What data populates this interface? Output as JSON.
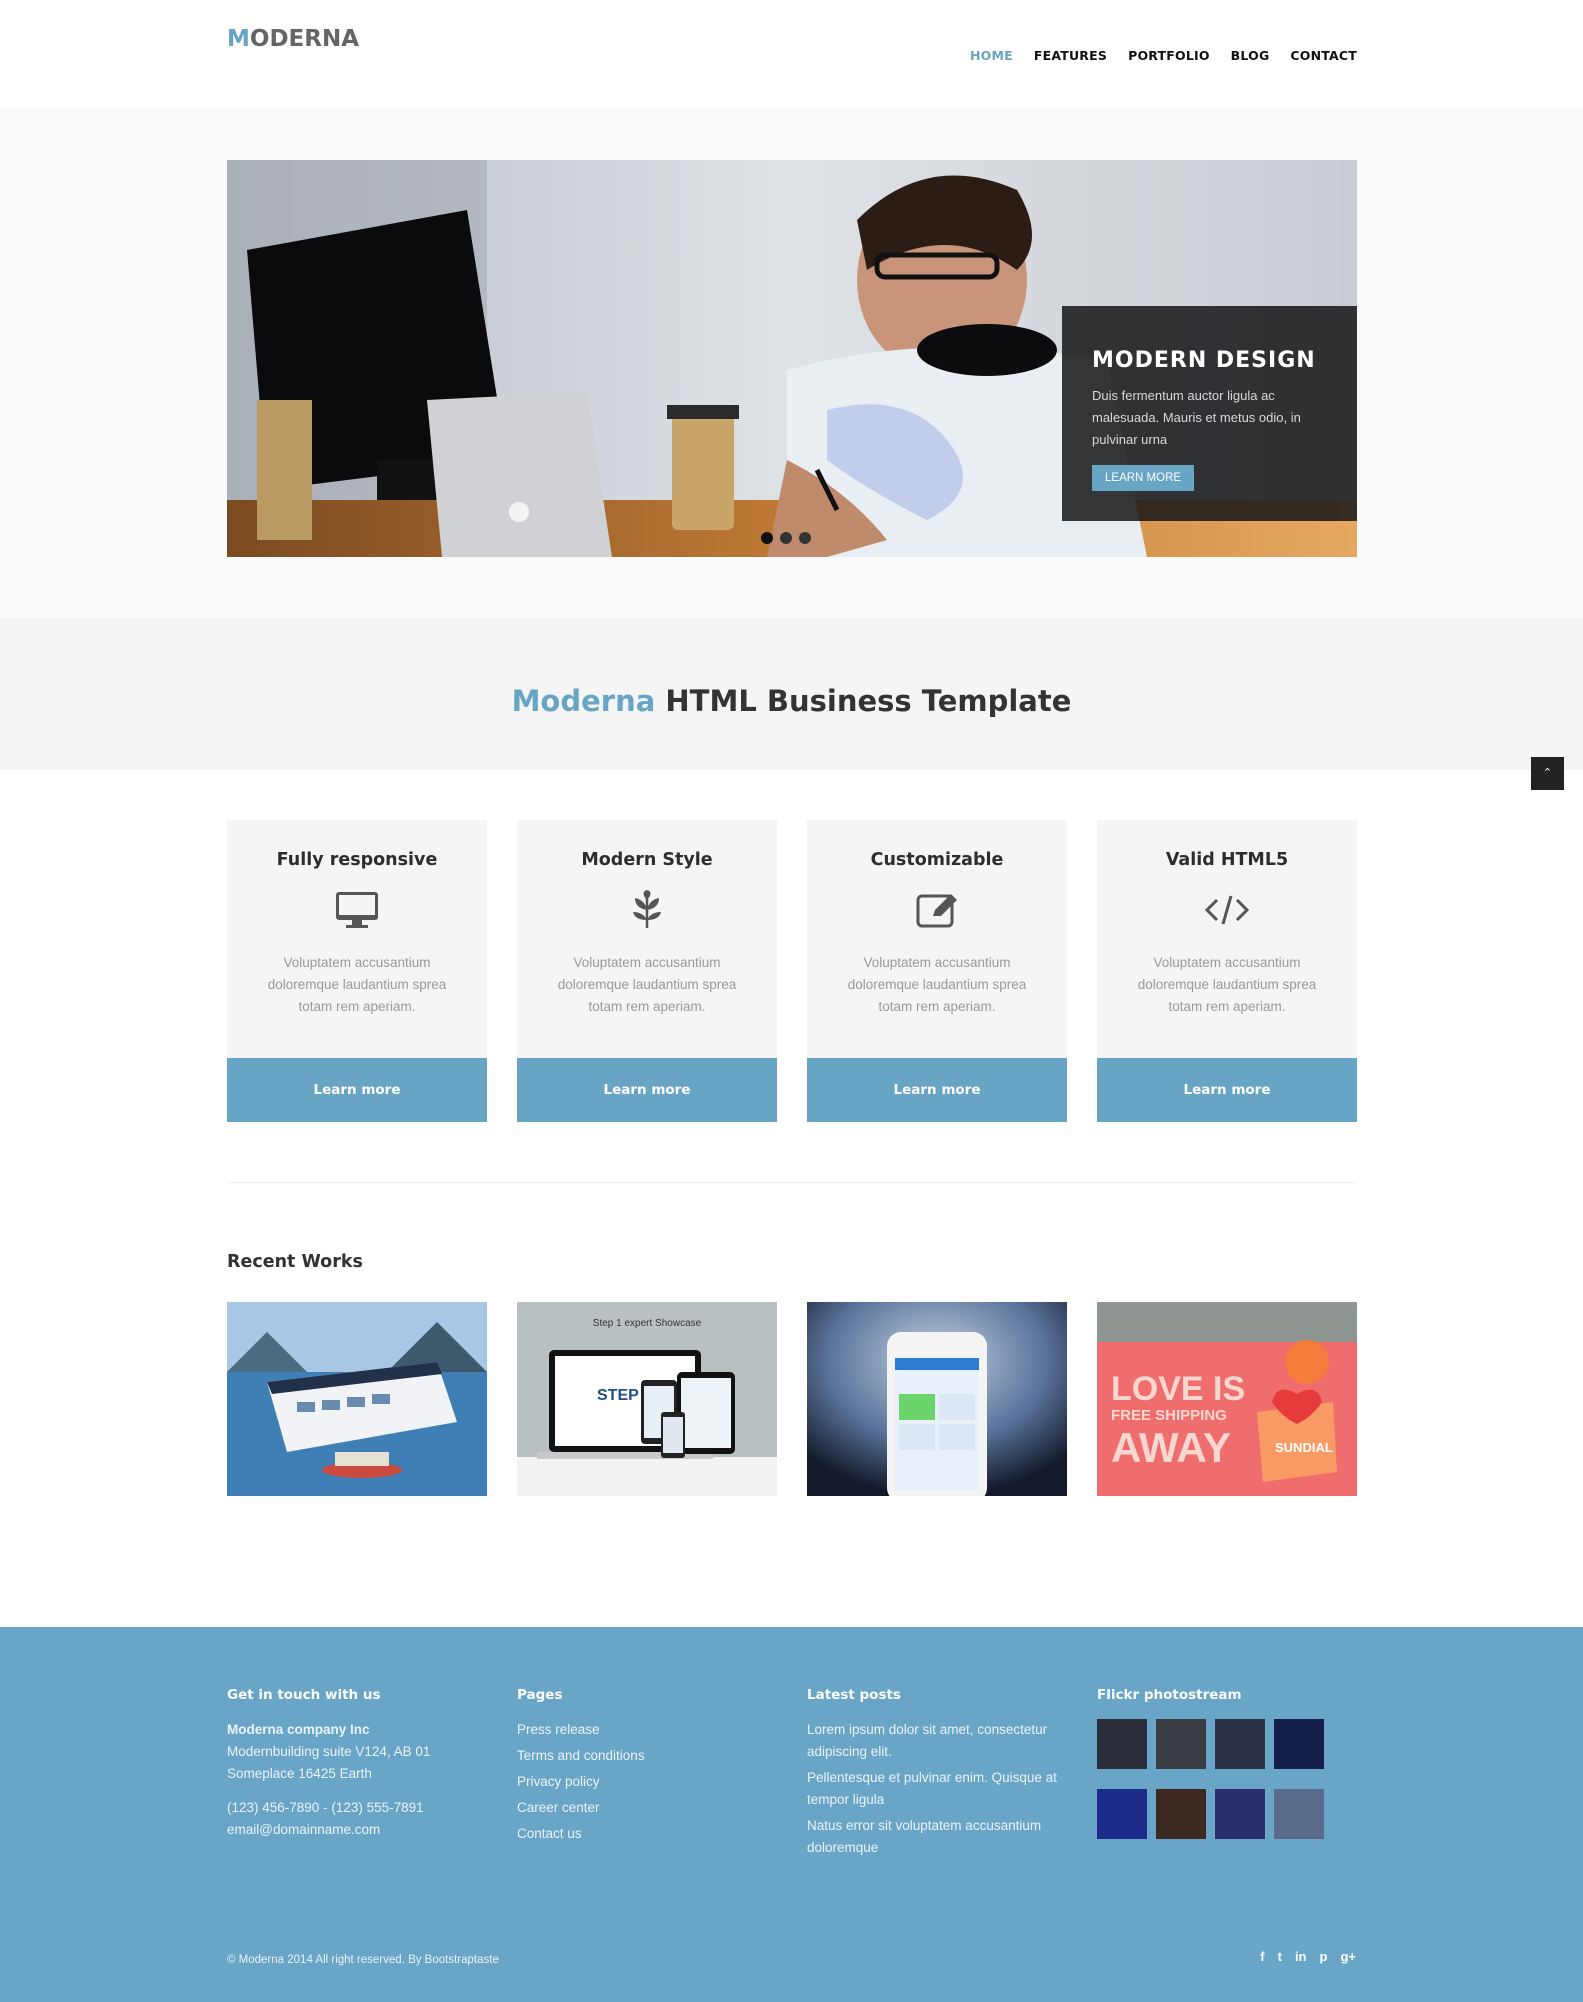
{
  "brand": {
    "first_letter": "M",
    "rest": "ODERNA"
  },
  "nav": [
    "HOME",
    "FEATURES",
    "PORTFOLIO",
    "BLOG",
    "CONTACT"
  ],
  "slider": {
    "title": "MODERN DESIGN",
    "text": "Duis fermentum auctor ligula ac malesuada. Mauris et metus odio, in pulvinar urna",
    "button": "LEARN MORE"
  },
  "callout": {
    "highlight": "Moderna",
    "rest": " HTML Business Template"
  },
  "scroll_top_icon": "⌃",
  "features": [
    {
      "title": "Fully responsive",
      "icon": "desktop-icon",
      "text": "Voluptatem accusantium doloremque laudantium sprea totam rem aperiam.",
      "button": "Learn more"
    },
    {
      "title": "Modern Style",
      "icon": "leaf-icon",
      "text": "Voluptatem accusantium doloremque laudantium sprea totam rem aperiam.",
      "button": "Learn more"
    },
    {
      "title": "Customizable",
      "icon": "edit-icon",
      "text": "Voluptatem accusantium doloremque laudantium sprea totam rem aperiam.",
      "button": "Learn more"
    },
    {
      "title": "Valid HTML5",
      "icon": "code-icon",
      "text": "Voluptatem accusantium doloremque laudantium sprea totam rem aperiam.",
      "button": "Learn more"
    }
  ],
  "recent_works": {
    "title": "Recent Works",
    "items": [
      {
        "name": "lake-website-mockup"
      },
      {
        "name": "step1-showcase",
        "caption": "Step 1 expert Showcase"
      },
      {
        "name": "phone-app"
      },
      {
        "name": "love-is-away",
        "lines": [
          "LOVE IS",
          "FREE SHIPPING",
          "AWAY"
        ],
        "brand": "SUNDIAL"
      }
    ]
  },
  "footer": {
    "contact": {
      "heading": "Get in touch with us",
      "company": "Moderna company Inc",
      "address1": "Modernbuilding suite V124, AB 01",
      "address2": "Someplace 16425 Earth",
      "phones": "(123) 456-7890 - (123) 555-7891",
      "email": "email@domainname.com"
    },
    "pages": {
      "heading": "Pages",
      "links": [
        "Press release",
        "Terms and conditions",
        "Privacy policy",
        "Career center",
        "Contact us"
      ]
    },
    "posts": {
      "heading": "Latest posts",
      "items": [
        "Lorem ipsum dolor sit amet, consectetur adipiscing elit.",
        "Pellentesque et pulvinar enim. Quisque at tempor ligula",
        "Natus error sit voluptatem accusantium doloremque"
      ]
    },
    "flickr": {
      "heading": "Flickr photostream",
      "thumb_colors": [
        "#2b2c3a",
        "#3a3d44",
        "#2a3146",
        "#15204a",
        "#1c2a8a",
        "#3c2a22",
        "#2a2e6a",
        "#5a6a8a"
      ]
    },
    "copyright": "© Moderna 2014 All right reserved. By Bootstraptaste",
    "social": [
      "f",
      "t",
      "in",
      "p",
      "g+"
    ]
  },
  "colors": {
    "accent": "#68a4c4",
    "footer_bg": "#69a5c6"
  }
}
